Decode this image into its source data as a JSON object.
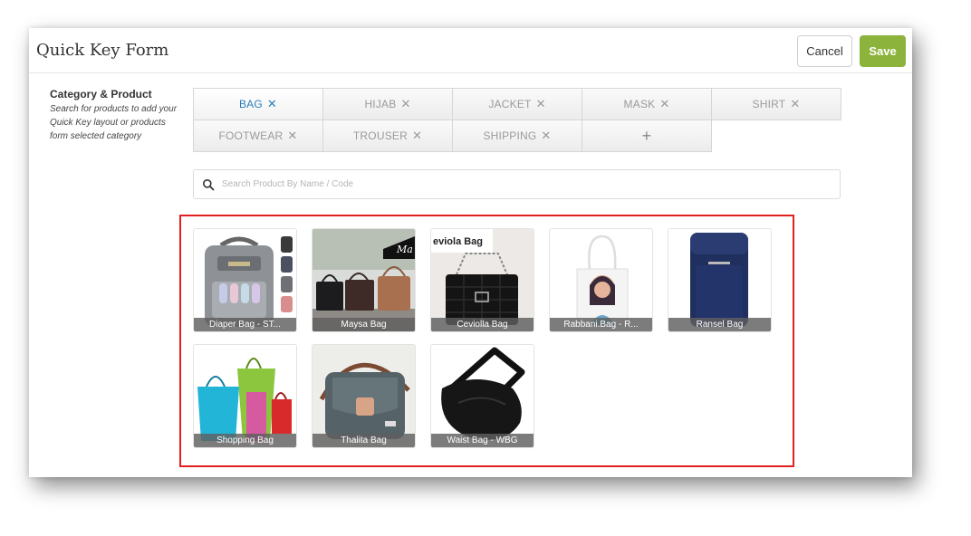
{
  "header": {
    "title": "Quick Key Form",
    "cancel_label": "Cancel",
    "save_label": "Save"
  },
  "section": {
    "title": "Category & Product",
    "description": "Search for products to add your Quick Key layout or products form selected category"
  },
  "categories": [
    {
      "label": "BAG",
      "active": true
    },
    {
      "label": "HIJAB",
      "active": false
    },
    {
      "label": "JACKET",
      "active": false
    },
    {
      "label": "MASK",
      "active": false
    },
    {
      "label": "SHIRT",
      "active": false
    },
    {
      "label": "FOOTWEAR",
      "active": false
    },
    {
      "label": "TROUSER",
      "active": false
    },
    {
      "label": "SHIPPING",
      "active": false
    }
  ],
  "remove_glyph": "✕",
  "add_glyph": "+",
  "search": {
    "placeholder": "Search Product By Name / Code",
    "value": ""
  },
  "products": [
    {
      "name": "Diaper Bag - ST...",
      "icon": "diaper-bag-icon"
    },
    {
      "name": "Maysa Bag",
      "icon": "maysa-bag-icon"
    },
    {
      "name": "Ceviolla Bag",
      "icon": "ceviolla-bag-icon"
    },
    {
      "name": "Rabbani.Bag - R...",
      "icon": "tote-bag-icon"
    },
    {
      "name": "Ransel Bag",
      "icon": "backpack-icon"
    },
    {
      "name": "Shopping Bag",
      "icon": "shopping-bag-icon"
    },
    {
      "name": "Thalita Bag",
      "icon": "thalita-bag-icon"
    },
    {
      "name": "Waist Bag - WBG",
      "icon": "waist-bag-icon"
    }
  ],
  "thumb_texts": {
    "maysa": "Ma",
    "ceviolla": "eviola Bag"
  },
  "colors": {
    "accent": "#2a80b9",
    "save": "#8cb33c",
    "highlight": "#e32020"
  }
}
